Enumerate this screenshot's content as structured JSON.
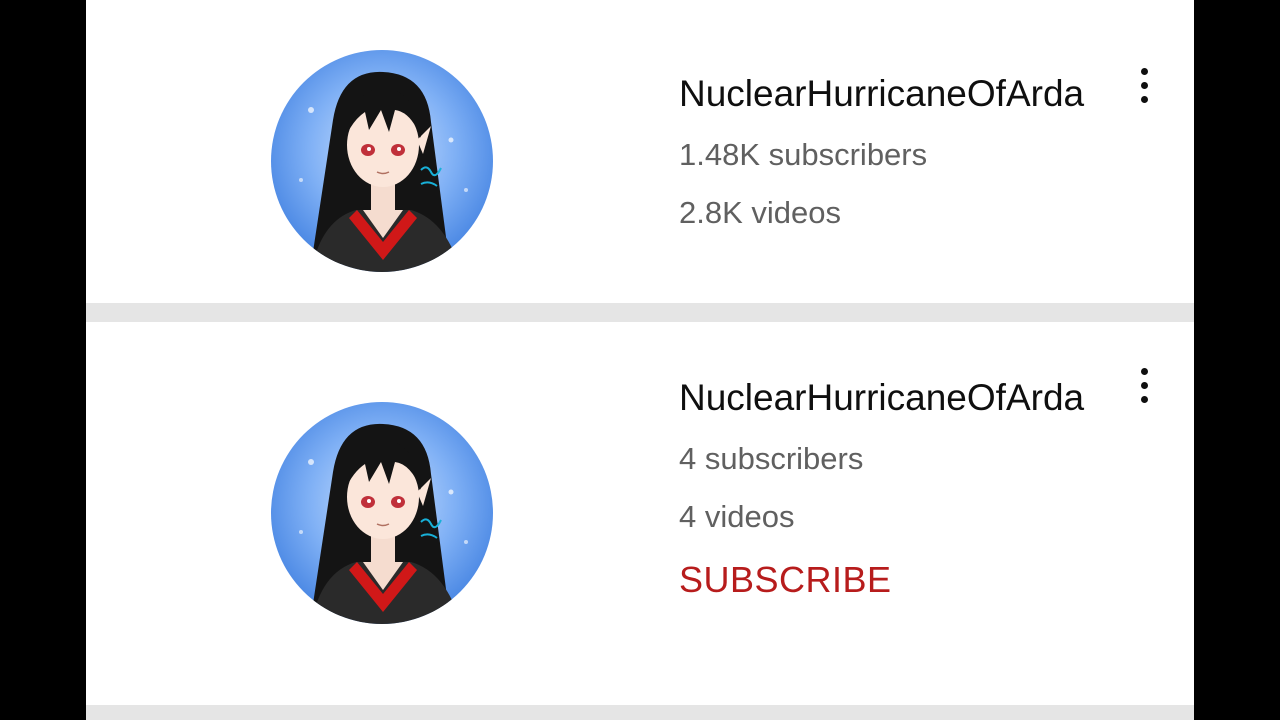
{
  "channels": [
    {
      "name": "NuclearHurricaneOfArda",
      "subscribers": "1.48K subscribers",
      "videos": "2.8K videos",
      "menu_icon": "more-vert-icon"
    },
    {
      "name": "NuclearHurricaneOfArda",
      "subscribers": "4 subscribers",
      "videos": "4 videos",
      "subscribe_label": "SUBSCRIBE",
      "menu_icon": "more-vert-icon"
    }
  ],
  "colors": {
    "subscribe_red": "#b71c1c",
    "meta_gray": "#606060",
    "divider_gray": "#e5e5e5"
  }
}
